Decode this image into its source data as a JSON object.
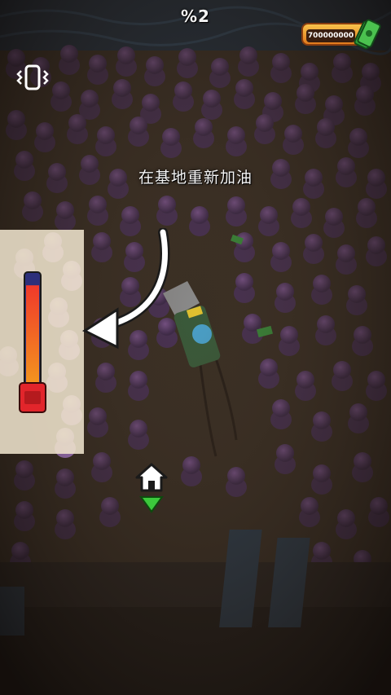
{
  "hud": {
    "progress_text": "%2",
    "cash_amount": "700000000",
    "cash_icon": "cash-stack-icon",
    "vibration_icon": "phone-vibrate-icon"
  },
  "hint": {
    "text": "在基地重新加油",
    "arrow_icon": "curved-arrow-left-icon"
  },
  "fuel": {
    "level": 0.9,
    "icon": "fuel-can-icon",
    "colors": {
      "high": "#f0392a",
      "low": "#f39a1e",
      "top": "#2d2f7a"
    }
  },
  "home": {
    "icon": "home-icon",
    "pointer": "green-arrow-down-icon"
  },
  "colors": {
    "zombie": "#5b3b6a",
    "zombie_highlight": "#d7a6ff",
    "ground": "#3a2f24",
    "water": "#233344"
  }
}
